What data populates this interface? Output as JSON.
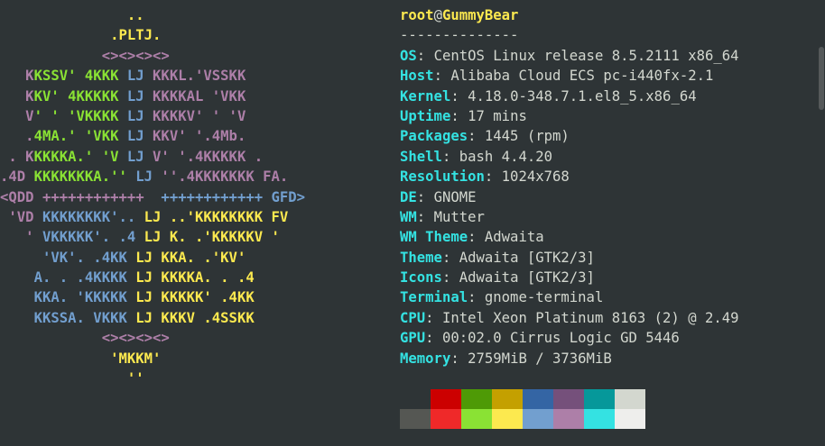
{
  "colors": {
    "background": "#2e3436",
    "foreground": "#d3d7cf",
    "key": "#34e2e2",
    "title": "#fce94f",
    "logo_purple": "#ad7fa8",
    "logo_yellow": "#fce94f",
    "logo_green": "#8ae234",
    "logo_blue": "#729fcf"
  },
  "logo": {
    "lines": [
      "               ..",
      "             .PLTJ.",
      "            <><><><>",
      "   KKSSV' 4KKK LJ KKKL.'VSSKK",
      "   KKV' 4KKKKK LJ KKKKAL 'VKK",
      "   V' ' 'VKKKK LJ KKKKV' ' 'V",
      "   .4MA.' 'VKK LJ KKV' '.4Mb.",
      " . KKKKKA.' 'V LJ V' '.4KKKKK .",
      ".4D KKKKKKKA.'' LJ ''.4KKKKKKK FA.",
      "<QDD ++++++++++++  ++++++++++++ GFD>",
      " 'VD KKKKKKKK'.. LJ ..'KKKKKKKK FV",
      "   ' VKKKKK'. .4 LJ K. .'KKKKKV '",
      "     'VK'. .4KK LJ KKA. .'KV'",
      "    A. . .4KKKK LJ KKKKA. . .4",
      "    KKA. 'KKKKK LJ KKKKK' .4KK",
      "    KKSSA. VKKK LJ KKKV .4SSKK",
      "            <><><><>",
      "             'MKKM'",
      "               ''"
    ]
  },
  "info": {
    "user": "root",
    "at": "@",
    "host": "GummyBear",
    "separator": "--------------",
    "fields": [
      {
        "key": "OS",
        "value": "CentOS Linux release 8.5.2111 x86_64"
      },
      {
        "key": "Host",
        "value": "Alibaba Cloud ECS pc-i440fx-2.1"
      },
      {
        "key": "Kernel",
        "value": "4.18.0-348.7.1.el8_5.x86_64"
      },
      {
        "key": "Uptime",
        "value": "17 mins"
      },
      {
        "key": "Packages",
        "value": "1445 (rpm)"
      },
      {
        "key": "Shell",
        "value": "bash 4.4.20"
      },
      {
        "key": "Resolution",
        "value": "1024x768"
      },
      {
        "key": "DE",
        "value": "GNOME"
      },
      {
        "key": "WM",
        "value": "Mutter"
      },
      {
        "key": "WM Theme",
        "value": "Adwaita"
      },
      {
        "key": "Theme",
        "value": "Adwaita [GTK2/3]"
      },
      {
        "key": "Icons",
        "value": "Adwaita [GTK2/3]"
      },
      {
        "key": "Terminal",
        "value": "gnome-terminal"
      },
      {
        "key": "CPU",
        "value": "Intel Xeon Platinum 8163 (2) @ 2.49"
      },
      {
        "key": "GPU",
        "value": "00:02.0 Cirrus Logic GD 5446"
      },
      {
        "key": "Memory",
        "value": "2759MiB / 3736MiB"
      }
    ]
  },
  "palette": [
    "#2e3436",
    "#cc0000",
    "#4e9a06",
    "#c4a000",
    "#3465a4",
    "#75507b",
    "#06989a",
    "#d3d7cf",
    "#555753",
    "#ef2929",
    "#8ae234",
    "#fce94f",
    "#729fcf",
    "#ad7fa8",
    "#34e2e2",
    "#eeeeec"
  ]
}
